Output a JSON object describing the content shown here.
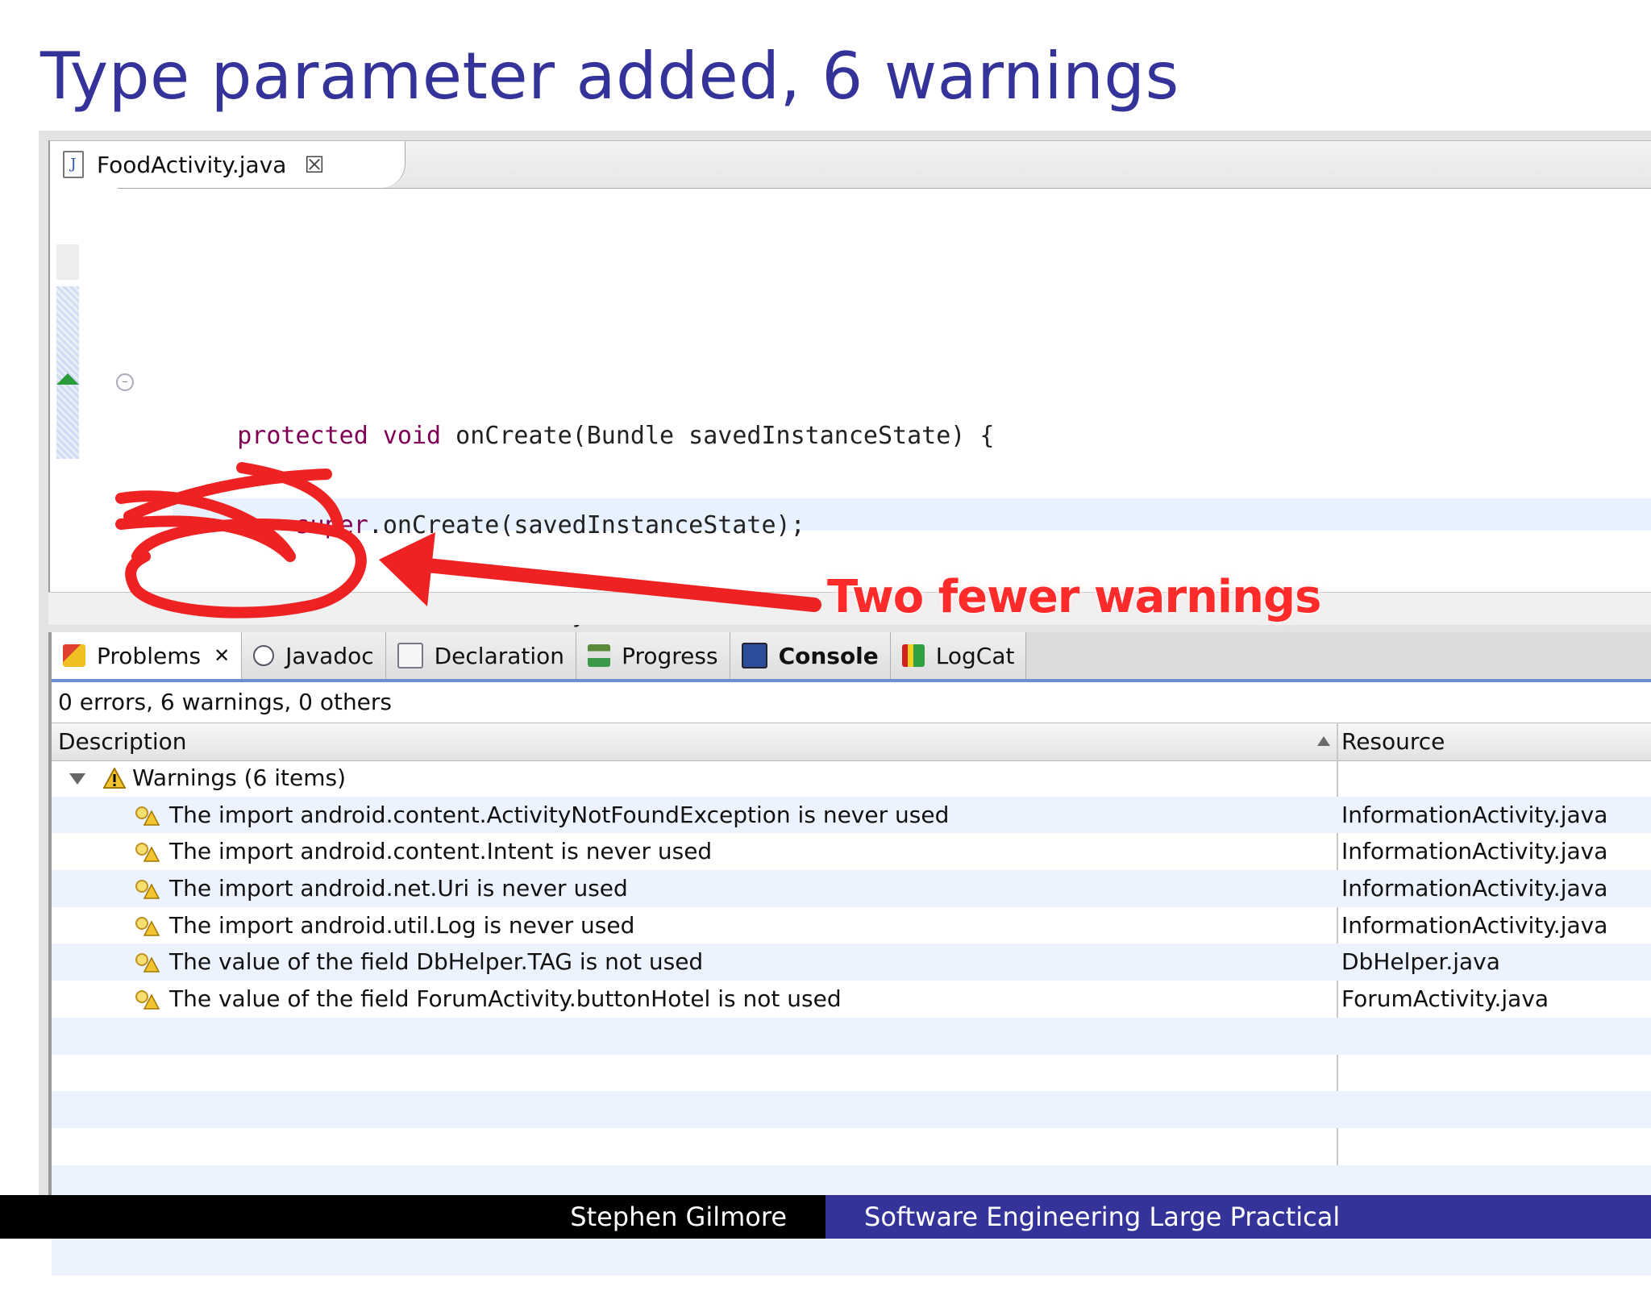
{
  "slide": {
    "title": "Type parameter added, 6 warnings",
    "annotation": "Two fewer warnings"
  },
  "editor": {
    "tab_label": "FoodActivity.java",
    "close_glyph": "☒"
  },
  "panel": {
    "tabs": [
      {
        "label": "Problems"
      },
      {
        "label": "Javadoc"
      },
      {
        "label": "Declaration"
      },
      {
        "label": "Progress"
      },
      {
        "label": "Console"
      },
      {
        "label": "LogCat"
      }
    ],
    "status": "0 errors, 6 warnings, 0 others",
    "columns": {
      "description": "Description",
      "resource": "Resource"
    },
    "group_label": "Warnings (6 items)",
    "warnings": [
      {
        "desc": "The import android.content.ActivityNotFoundException is never used",
        "res": "InformationActivity.java"
      },
      {
        "desc": "The import android.content.Intent is never used",
        "res": "InformationActivity.java"
      },
      {
        "desc": "The import android.net.Uri is never used",
        "res": "InformationActivity.java"
      },
      {
        "desc": "The import android.util.Log is never used",
        "res": "InformationActivity.java"
      },
      {
        "desc": "The value of the field DbHelper.TAG is not used",
        "res": "DbHelper.java"
      },
      {
        "desc": "The value of the field ForumActivity.buttonHotel is not used",
        "res": "ForumActivity.java"
      }
    ]
  },
  "footer": {
    "author": "Stephen Gilmore",
    "course": "Software Engineering Large Practical"
  },
  "colors": {
    "title": "#333399",
    "annotation": "#ff2a2a",
    "footer_left": "#000000",
    "footer_right": "#333399"
  }
}
